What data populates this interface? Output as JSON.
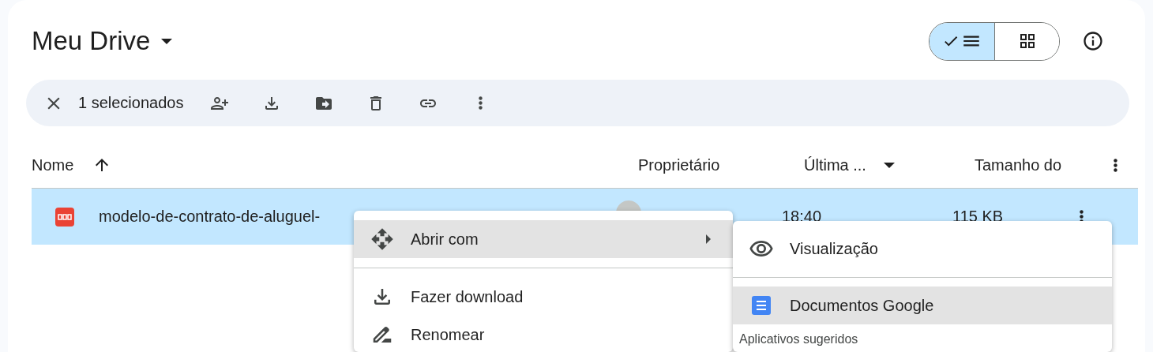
{
  "header": {
    "title": "Meu Drive",
    "view_toggle": [
      {
        "kind": "list",
        "selected": true
      },
      {
        "kind": "grid",
        "selected": false
      }
    ]
  },
  "selection_bar": {
    "count": "1 selecionados"
  },
  "table": {
    "columns": [
      {
        "label": "Nome",
        "kind": "sort-asc"
      },
      {
        "label": "Proprietário",
        "kind": "plain"
      },
      {
        "label": "Última ...",
        "kind": "dropdown"
      },
      {
        "label": "Tamanho do",
        "kind": "plain"
      }
    ],
    "rows": [
      {
        "name": "modelo-de-contrato-de-aluguel-",
        "modified": "18:40",
        "size": "115 KB",
        "selected": true
      }
    ]
  },
  "context_menu": {
    "items": [
      {
        "label": "Abrir com",
        "highlighted": true,
        "submenu": true
      },
      {
        "label": "Fazer download",
        "highlighted": false,
        "submenu": false
      },
      {
        "label": "Renomear",
        "highlighted": false,
        "submenu": false
      }
    ],
    "submenu": {
      "items": [
        {
          "label": "Visualização",
          "kind": "preview",
          "highlighted": false
        },
        {
          "label": "Documentos Google",
          "kind": "docs",
          "highlighted": true
        }
      ],
      "section": "Aplicativos sugeridos"
    }
  }
}
